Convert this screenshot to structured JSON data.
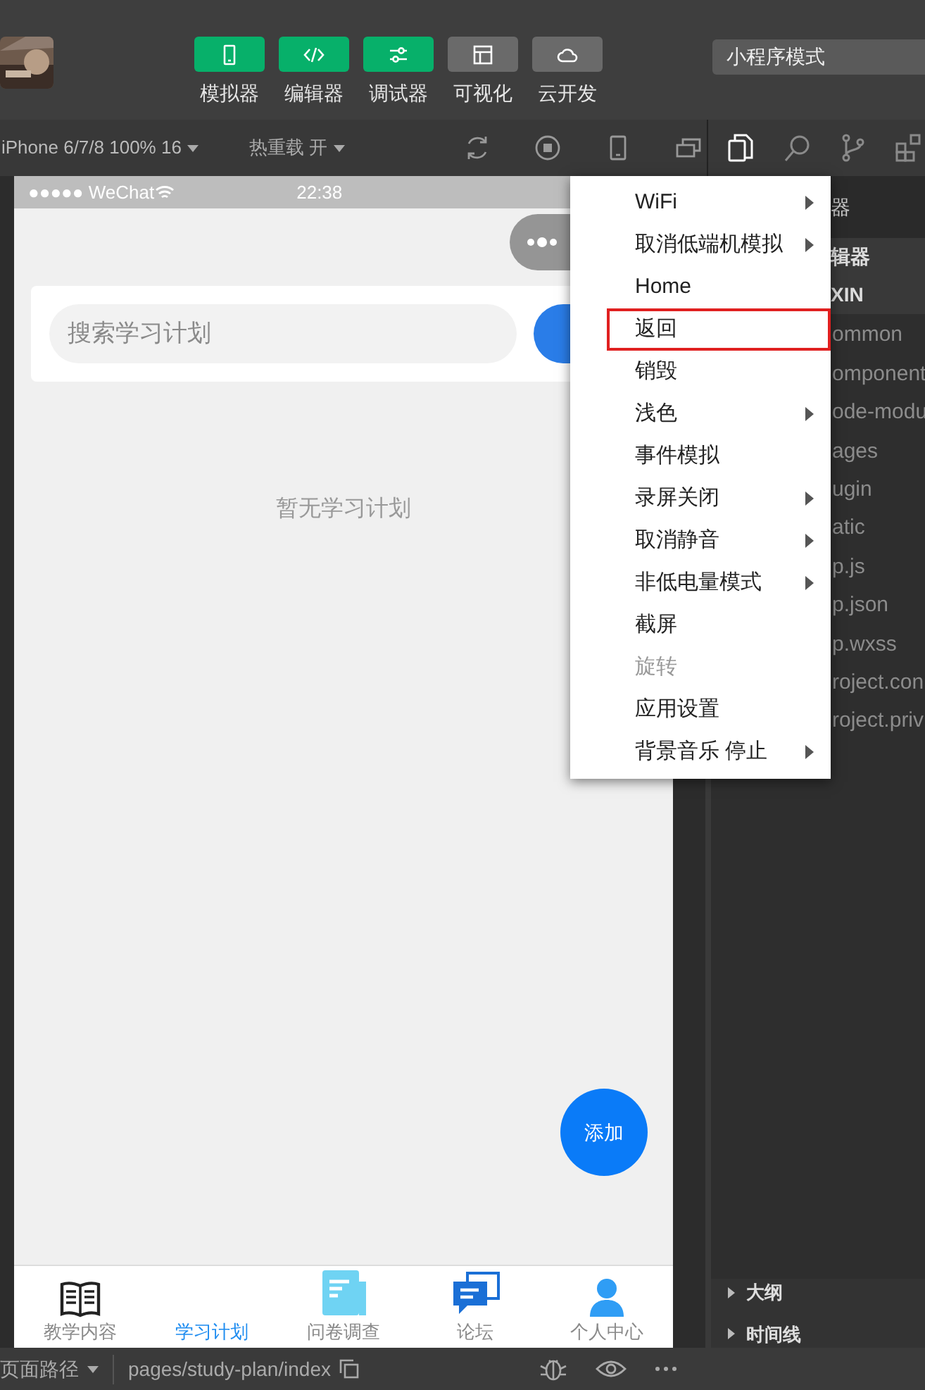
{
  "toolbar": {
    "buttons": [
      {
        "label": "模拟器",
        "active": true
      },
      {
        "label": "编辑器",
        "active": true
      },
      {
        "label": "调试器",
        "active": true
      },
      {
        "label": "可视化",
        "active": false
      },
      {
        "label": "云开发",
        "active": false
      }
    ],
    "mode_select": {
      "value": "小程序模式"
    }
  },
  "sim_bar": {
    "device": "iPhone 6/7/8 100% 16",
    "hot_reload": "热重载 开"
  },
  "activity_bar": [
    {
      "selected": true
    },
    {
      "selected": false
    },
    {
      "selected": false
    },
    {
      "selected": false
    }
  ],
  "phone": {
    "carrier": "●●●●● WeChat",
    "time": "22:38",
    "search": {
      "placeholder": "搜索学习计划"
    },
    "empty_text": "暂无学习计划",
    "fab": "添加",
    "tabs": [
      {
        "label": "教学内容",
        "selected": false
      },
      {
        "label": "学习计划",
        "selected": true
      },
      {
        "label": "问卷调查",
        "selected": false
      },
      {
        "label": "论坛",
        "selected": false
      },
      {
        "label": "个人中心",
        "selected": false
      }
    ]
  },
  "context_menu": [
    {
      "label": "WiFi",
      "kind": "submenu",
      "disabled": false,
      "outlined": false
    },
    {
      "label": "取消低端机模拟",
      "kind": "submenu",
      "disabled": false,
      "outlined": false
    },
    {
      "label": "Home",
      "kind": "action",
      "disabled": false,
      "outlined": false
    },
    {
      "label": "返回",
      "kind": "action",
      "disabled": false,
      "outlined": true
    },
    {
      "label": "销毁",
      "kind": "action",
      "disabled": false,
      "outlined": false
    },
    {
      "label": "浅色",
      "kind": "submenu",
      "disabled": false,
      "outlined": false
    },
    {
      "label": "事件模拟",
      "kind": "action",
      "disabled": false,
      "outlined": false
    },
    {
      "label": "录屏关闭",
      "kind": "submenu",
      "disabled": false,
      "outlined": false
    },
    {
      "label": "取消静音",
      "kind": "submenu",
      "disabled": false,
      "outlined": false
    },
    {
      "label": "非低电量模式",
      "kind": "submenu",
      "disabled": false,
      "outlined": false
    },
    {
      "label": "截屏",
      "kind": "action",
      "disabled": false,
      "outlined": false
    },
    {
      "label": "旋转",
      "kind": "action",
      "disabled": true,
      "outlined": false
    },
    {
      "label": "应用设置",
      "kind": "action",
      "disabled": false,
      "outlined": false
    },
    {
      "label": "背景音乐 停止",
      "kind": "submenu",
      "disabled": false,
      "outlined": false
    }
  ],
  "explorer": {
    "title": "器",
    "section": "辑器",
    "project": "XIN",
    "files": [
      "ommon",
      "omponent",
      "ode-modu",
      "ages",
      "ugin",
      "atic",
      "p.js",
      "p.json",
      "p.wxss",
      "roject.con",
      "roject.priv"
    ],
    "panels": [
      "大纲",
      "时间线"
    ]
  },
  "status_bar": {
    "path_label": "页面路径",
    "path": "pages/study-plan/index"
  }
}
